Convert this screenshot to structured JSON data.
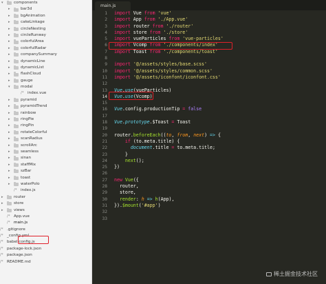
{
  "tree": [
    {
      "label": "components",
      "level": 0,
      "type": "folder",
      "expanded": true
    },
    {
      "label": "bar3d",
      "level": 1,
      "type": "folder"
    },
    {
      "label": "bgAnimation",
      "level": 1,
      "type": "folder"
    },
    {
      "label": "cakeLinkage",
      "level": 1,
      "type": "folder"
    },
    {
      "label": "circleNesting",
      "level": 1,
      "type": "folder"
    },
    {
      "label": "circleRunway",
      "level": 1,
      "type": "folder"
    },
    {
      "label": "colorfulArea",
      "level": 1,
      "type": "folder"
    },
    {
      "label": "colorfulRadar",
      "level": 1,
      "type": "folder"
    },
    {
      "label": "companySummary",
      "level": 1,
      "type": "folder"
    },
    {
      "label": "dynamicLine",
      "level": 1,
      "type": "folder"
    },
    {
      "label": "dynamicList",
      "level": 1,
      "type": "folder"
    },
    {
      "label": "flashCloud",
      "level": 1,
      "type": "folder"
    },
    {
      "label": "gauge",
      "level": 1,
      "type": "folder"
    },
    {
      "label": "modal",
      "level": 1,
      "type": "folder",
      "expanded": true
    },
    {
      "label": "index.vue",
      "level": 2,
      "type": "file"
    },
    {
      "label": "pyramid",
      "level": 1,
      "type": "folder"
    },
    {
      "label": "pyramidTrend",
      "level": 1,
      "type": "folder"
    },
    {
      "label": "rainbow",
      "level": 1,
      "type": "folder"
    },
    {
      "label": "ringPie",
      "level": 1,
      "type": "folder"
    },
    {
      "label": "ringPin",
      "level": 1,
      "type": "folder"
    },
    {
      "label": "rotateColorful",
      "level": 1,
      "type": "folder"
    },
    {
      "label": "scanRadius",
      "level": 1,
      "type": "folder"
    },
    {
      "label": "scrollArc",
      "level": 1,
      "type": "folder"
    },
    {
      "label": "seamless",
      "level": 1,
      "type": "folder"
    },
    {
      "label": "sinan",
      "level": 1,
      "type": "folder"
    },
    {
      "label": "staffMix",
      "level": 1,
      "type": "folder"
    },
    {
      "label": "szBar",
      "level": 1,
      "type": "folder"
    },
    {
      "label": "toast",
      "level": 1,
      "type": "folder"
    },
    {
      "label": "waterPolo",
      "level": 1,
      "type": "folder"
    },
    {
      "label": "index.js",
      "level": 1,
      "type": "file"
    },
    {
      "label": "router",
      "level": 0,
      "type": "folder"
    },
    {
      "label": "store",
      "level": 0,
      "type": "folder"
    },
    {
      "label": "views",
      "level": 0,
      "type": "folder"
    },
    {
      "label": "App.vue",
      "level": 0,
      "type": "file"
    },
    {
      "label": "main.js",
      "level": 0,
      "type": "file",
      "selected": true
    },
    {
      "label": ".gitignore",
      "level": -1,
      "type": "file"
    },
    {
      "label": "_config.yml",
      "level": -1,
      "type": "file"
    },
    {
      "label": "babel.config.js",
      "level": -1,
      "type": "file"
    },
    {
      "label": "package-lock.json",
      "level": -1,
      "type": "file"
    },
    {
      "label": "package.json",
      "level": -1,
      "type": "file"
    },
    {
      "label": "README.md",
      "level": -1,
      "type": "file"
    }
  ],
  "editor": {
    "tab_label": "main.js",
    "current_line": 14,
    "lines": [
      [
        [
          "kw",
          "import"
        ],
        [
          "t",
          " Vue "
        ],
        [
          "kw",
          "from"
        ],
        [
          "t",
          " "
        ],
        [
          "str",
          "'vue'"
        ]
      ],
      [
        [
          "kw",
          "import"
        ],
        [
          "t",
          " App "
        ],
        [
          "kw",
          "from"
        ],
        [
          "t",
          " "
        ],
        [
          "str",
          "'./App.vue'"
        ]
      ],
      [
        [
          "kw",
          "import"
        ],
        [
          "t",
          " router "
        ],
        [
          "kw",
          "from"
        ],
        [
          "t",
          " "
        ],
        [
          "str",
          "'./router'"
        ]
      ],
      [
        [
          "kw",
          "import"
        ],
        [
          "t",
          " store "
        ],
        [
          "kw",
          "from"
        ],
        [
          "t",
          " "
        ],
        [
          "str",
          "'./store'"
        ]
      ],
      [
        [
          "kw",
          "import"
        ],
        [
          "t",
          " vueParticles "
        ],
        [
          "kw",
          "from"
        ],
        [
          "t",
          " "
        ],
        [
          "str",
          "'vue-particles'"
        ]
      ],
      [
        [
          "kw",
          "import"
        ],
        [
          "t",
          " Vcomp "
        ],
        [
          "kw",
          "from"
        ],
        [
          "t",
          " "
        ],
        [
          "str",
          "'./components/index'"
        ]
      ],
      [
        [
          "kw",
          "import"
        ],
        [
          "t",
          " Toast "
        ],
        [
          "kw",
          "from"
        ],
        [
          "t",
          " "
        ],
        [
          "str",
          "'./components/toast'"
        ]
      ],
      [],
      [
        [
          "kw",
          "import"
        ],
        [
          "t",
          " "
        ],
        [
          "str",
          "'@/assets/styles/base.scss'"
        ]
      ],
      [
        [
          "kw",
          "import"
        ],
        [
          "t",
          " "
        ],
        [
          "str",
          "'@/assets/styles/common.scss'"
        ]
      ],
      [
        [
          "kw",
          "import"
        ],
        [
          "t",
          " "
        ],
        [
          "str",
          "'@/assets/iconfont/iconfont.css'"
        ]
      ],
      [],
      [
        [
          "fn",
          "Vue"
        ],
        [
          "t",
          "."
        ],
        [
          "fn",
          "use"
        ],
        [
          "t",
          "(vueParticles)"
        ]
      ],
      [
        [
          "fn",
          "Vue"
        ],
        [
          "t",
          "."
        ],
        [
          "fn",
          "use"
        ],
        [
          "t",
          "(Vcomp)"
        ]
      ],
      [],
      [
        [
          "fn",
          "Vue"
        ],
        [
          "t",
          ".config.productionTip "
        ],
        [
          "kw",
          "="
        ],
        [
          "t",
          " "
        ],
        [
          "const",
          "false"
        ]
      ],
      [],
      [
        [
          "fn",
          "Vue"
        ],
        [
          "t",
          "."
        ],
        [
          "fn",
          "prototype"
        ],
        [
          "t",
          ".$Toast "
        ],
        [
          "kw",
          "="
        ],
        [
          "t",
          " Toast"
        ]
      ],
      [],
      [
        [
          "t",
          "router."
        ],
        [
          "call",
          "beforeEach"
        ],
        [
          "t",
          "(("
        ],
        [
          "param",
          "to"
        ],
        [
          "t",
          ", "
        ],
        [
          "param",
          "from"
        ],
        [
          "t",
          ", "
        ],
        [
          "param",
          "next"
        ],
        [
          "t",
          ") "
        ],
        [
          "fn",
          "=>"
        ],
        [
          "t",
          " {"
        ]
      ],
      [
        [
          "t",
          "    "
        ],
        [
          "kw",
          "if"
        ],
        [
          "t",
          " (to.meta.title) {"
        ]
      ],
      [
        [
          "t",
          "      "
        ],
        [
          "fn",
          "document"
        ],
        [
          "t",
          ".title "
        ],
        [
          "kw",
          "="
        ],
        [
          "t",
          " to.meta.title;"
        ]
      ],
      [
        [
          "t",
          "    }"
        ]
      ],
      [
        [
          "t",
          "    "
        ],
        [
          "call",
          "next"
        ],
        [
          "t",
          "();"
        ]
      ],
      [
        [
          "t",
          "})"
        ]
      ],
      [],
      [
        [
          "kw",
          "new"
        ],
        [
          "t",
          " "
        ],
        [
          "call",
          "Vue"
        ],
        [
          "t",
          "({"
        ]
      ],
      [
        [
          "t",
          "  router,"
        ]
      ],
      [
        [
          "t",
          "  store,"
        ]
      ],
      [
        [
          "t",
          "  "
        ],
        [
          "call",
          "render"
        ],
        [
          "t",
          ": "
        ],
        [
          "param",
          "h"
        ],
        [
          "t",
          " "
        ],
        [
          "fn",
          "=>"
        ],
        [
          "t",
          " "
        ],
        [
          "call",
          "h"
        ],
        [
          "t",
          "(App),"
        ]
      ],
      [
        [
          "t",
          "})."
        ],
        [
          "call",
          "$mount"
        ],
        [
          "t",
          "("
        ],
        [
          "str",
          "'#app'"
        ],
        [
          "t",
          ")"
        ]
      ],
      [],
      []
    ]
  },
  "watermark": "稀土掘金技术社区",
  "colors": {
    "editor_bg": "#272822",
    "keyword": "#f92672",
    "string": "#e6db74",
    "builtin": "#66d9ef",
    "param": "#fd971f",
    "function": "#a6e22e",
    "highlight": "#e0202a"
  }
}
